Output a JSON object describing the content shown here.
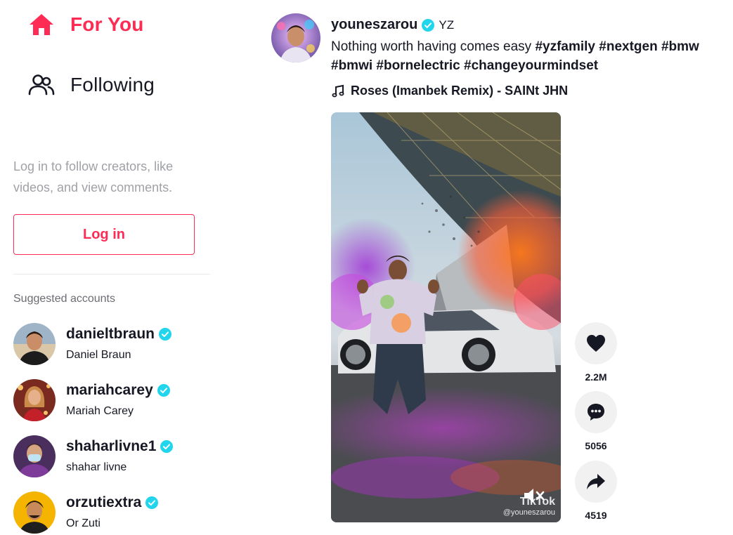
{
  "sidebar": {
    "nav": [
      {
        "label": "For You",
        "icon": "home-icon",
        "active": true
      },
      {
        "label": "Following",
        "icon": "following-users-icon",
        "active": false
      }
    ],
    "login_hint": "Log in to follow creators, like videos, and view comments.",
    "login_button": "Log in",
    "suggested_title": "Suggested accounts",
    "accounts": [
      {
        "handle": "danieltbraun",
        "name": "Daniel Braun",
        "verified": true
      },
      {
        "handle": "mariahcarey",
        "name": "Mariah Carey",
        "verified": true
      },
      {
        "handle": "shaharlivne1",
        "name": "shahar livne",
        "verified": true
      },
      {
        "handle": "orzutiextra",
        "name": "Or Zuti",
        "verified": true
      }
    ]
  },
  "post": {
    "author_handle": "youneszarou",
    "author_nickname": "YZ",
    "verified": true,
    "caption_text": "Nothing worth having comes easy",
    "hashtags": [
      "#yzfamily",
      "#nextgen",
      "#bmw",
      "#bmwi",
      "#bornelectric",
      "#changeyourmindset"
    ],
    "music": "Roses (Imanbek Remix) - SAINt JHN",
    "watermark_logo": "TikTok",
    "watermark_user": "@youneszarou",
    "actions": [
      {
        "icon": "heart-icon",
        "count": "2.2M"
      },
      {
        "icon": "comment-icon",
        "count": "5056"
      },
      {
        "icon": "share-icon",
        "count": "4519"
      }
    ]
  },
  "colors": {
    "brand": "#fe2c55",
    "verified": "#20d5ec",
    "text": "#161823",
    "muted": "#a0a1a7",
    "action_bg": "#f1f1f2"
  }
}
